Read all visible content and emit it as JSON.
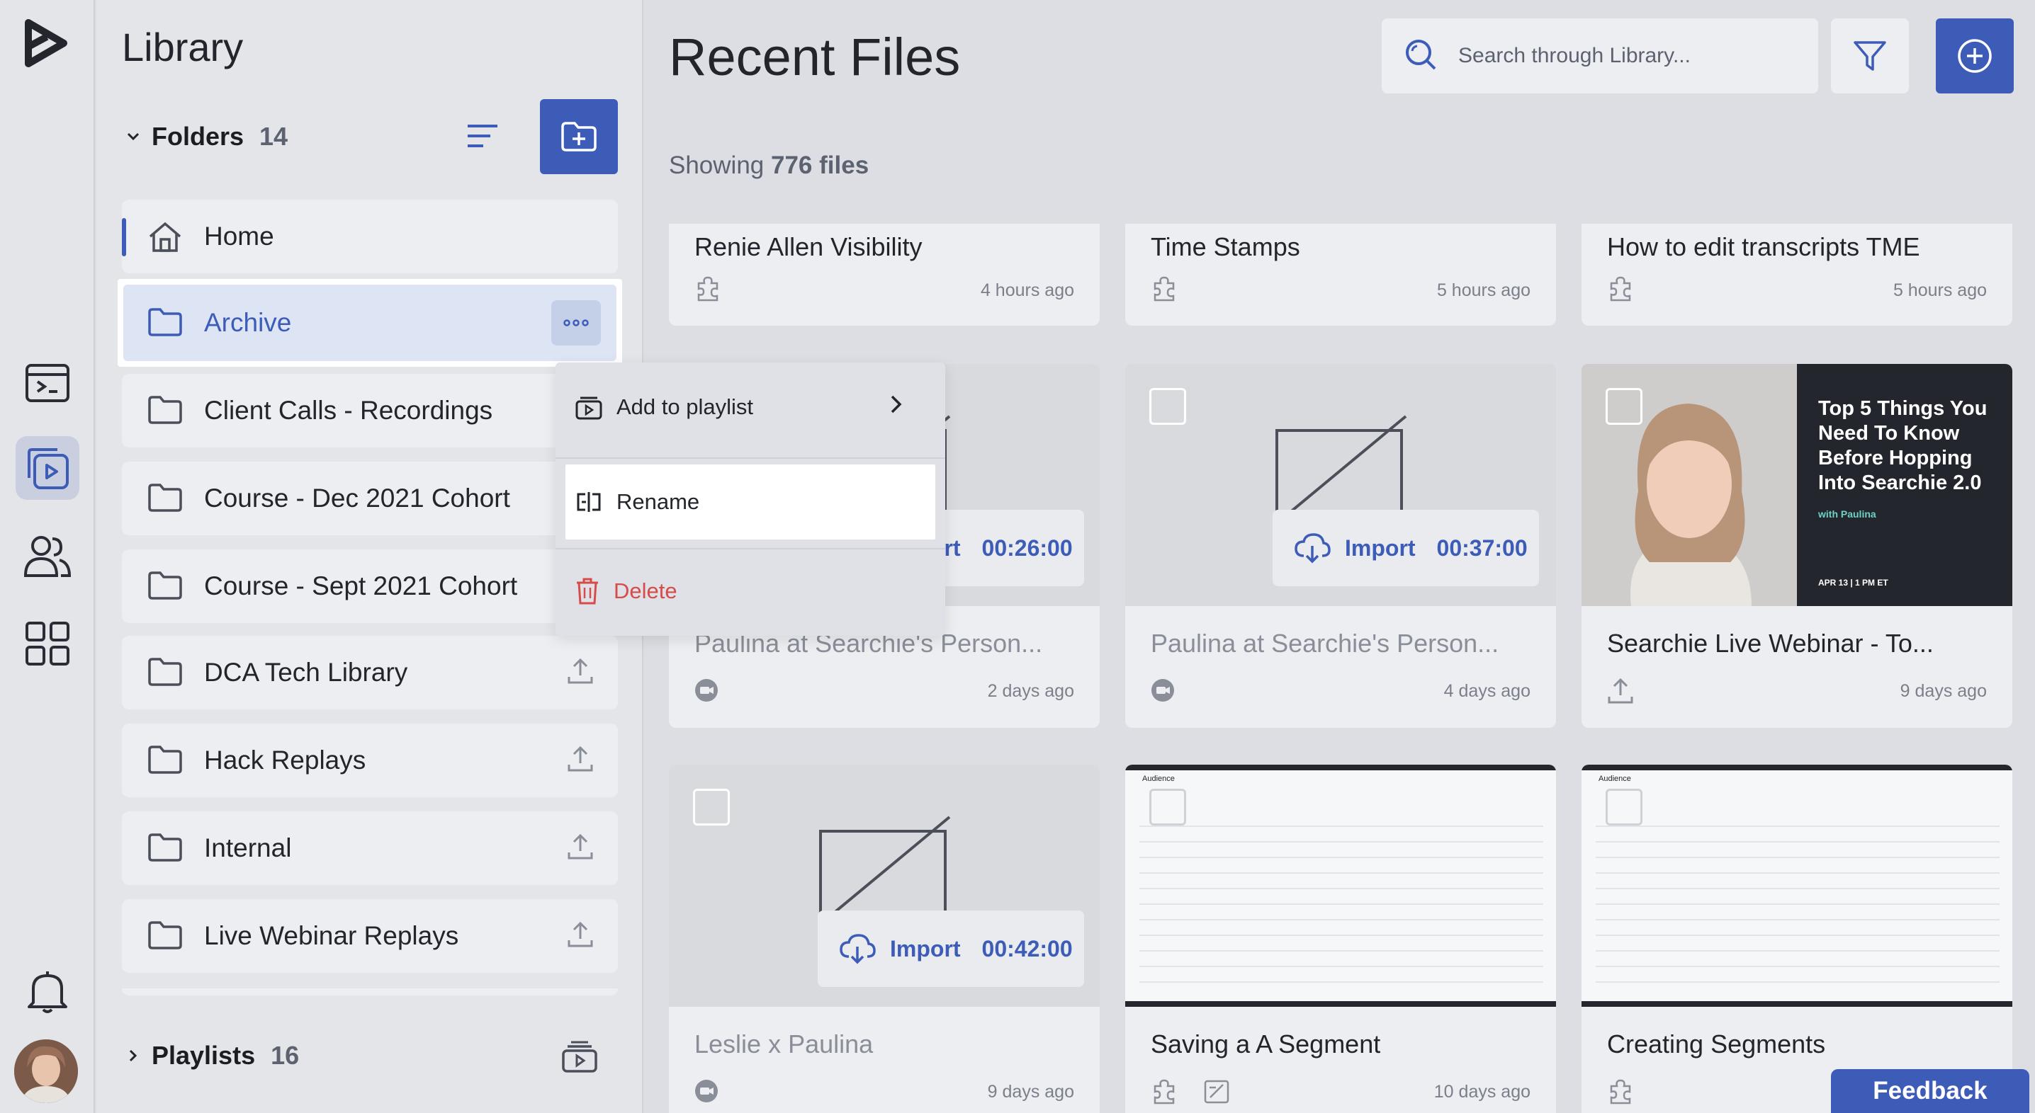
{
  "sidebar": {
    "title": "Library",
    "folders_label": "Folders",
    "folders_count": "14",
    "folders": [
      {
        "label": "Home"
      },
      {
        "label": "Archive"
      },
      {
        "label": "Client Calls - Recordings"
      },
      {
        "label": "Course - Dec 2021 Cohort"
      },
      {
        "label": "Course - Sept 2021 Cohort"
      },
      {
        "label": "DCA Tech Library"
      },
      {
        "label": "Hack Replays"
      },
      {
        "label": "Internal"
      },
      {
        "label": "Live Webinar Replays"
      }
    ],
    "playlists_label": "Playlists",
    "playlists_count": "16"
  },
  "main": {
    "title": "Recent Files",
    "search_placeholder": "Search through Library...",
    "showing_prefix": "Showing",
    "showing_count": "776 files",
    "cards": [
      {
        "title": "Renie Allen Visibility",
        "time": "4 hours ago"
      },
      {
        "title": "Time Stamps",
        "time": "5 hours ago"
      },
      {
        "title": "How to edit transcripts TME",
        "time": "5 hours ago"
      },
      {
        "title": "Paulina at Searchie's Person...",
        "time": "2 days ago",
        "import_label": "Import",
        "duration": "00:26:00"
      },
      {
        "title": "Paulina at Searchie's Person...",
        "time": "4 days ago",
        "import_label": "Import",
        "duration": "00:37:00"
      },
      {
        "title": "Searchie Live Webinar - To...",
        "time": "9 days ago"
      },
      {
        "title": "Leslie x Paulina",
        "time": "9 days ago",
        "import_label": "Import",
        "duration": "00:42:00"
      },
      {
        "title": "Saving a A Segment",
        "time": "10 days ago"
      },
      {
        "title": "Creating Segments",
        "time": ""
      }
    ],
    "webinar_thumb": {
      "headline": "Top 5 Things You Need To Know Before Hopping Into Searchie 2.0",
      "with": "with Paulina",
      "date": "APR 13 | 1 PM ET"
    },
    "screen_thumb_heading": "Audience"
  },
  "context_menu": {
    "items": [
      {
        "label": "Add to playlist"
      },
      {
        "label": "Rename"
      },
      {
        "label": "Delete"
      }
    ]
  },
  "feedback_label": "Feedback",
  "colors": {
    "accent": "#3d5cb8",
    "danger": "#d84b4b",
    "background": "#dcdee3"
  }
}
